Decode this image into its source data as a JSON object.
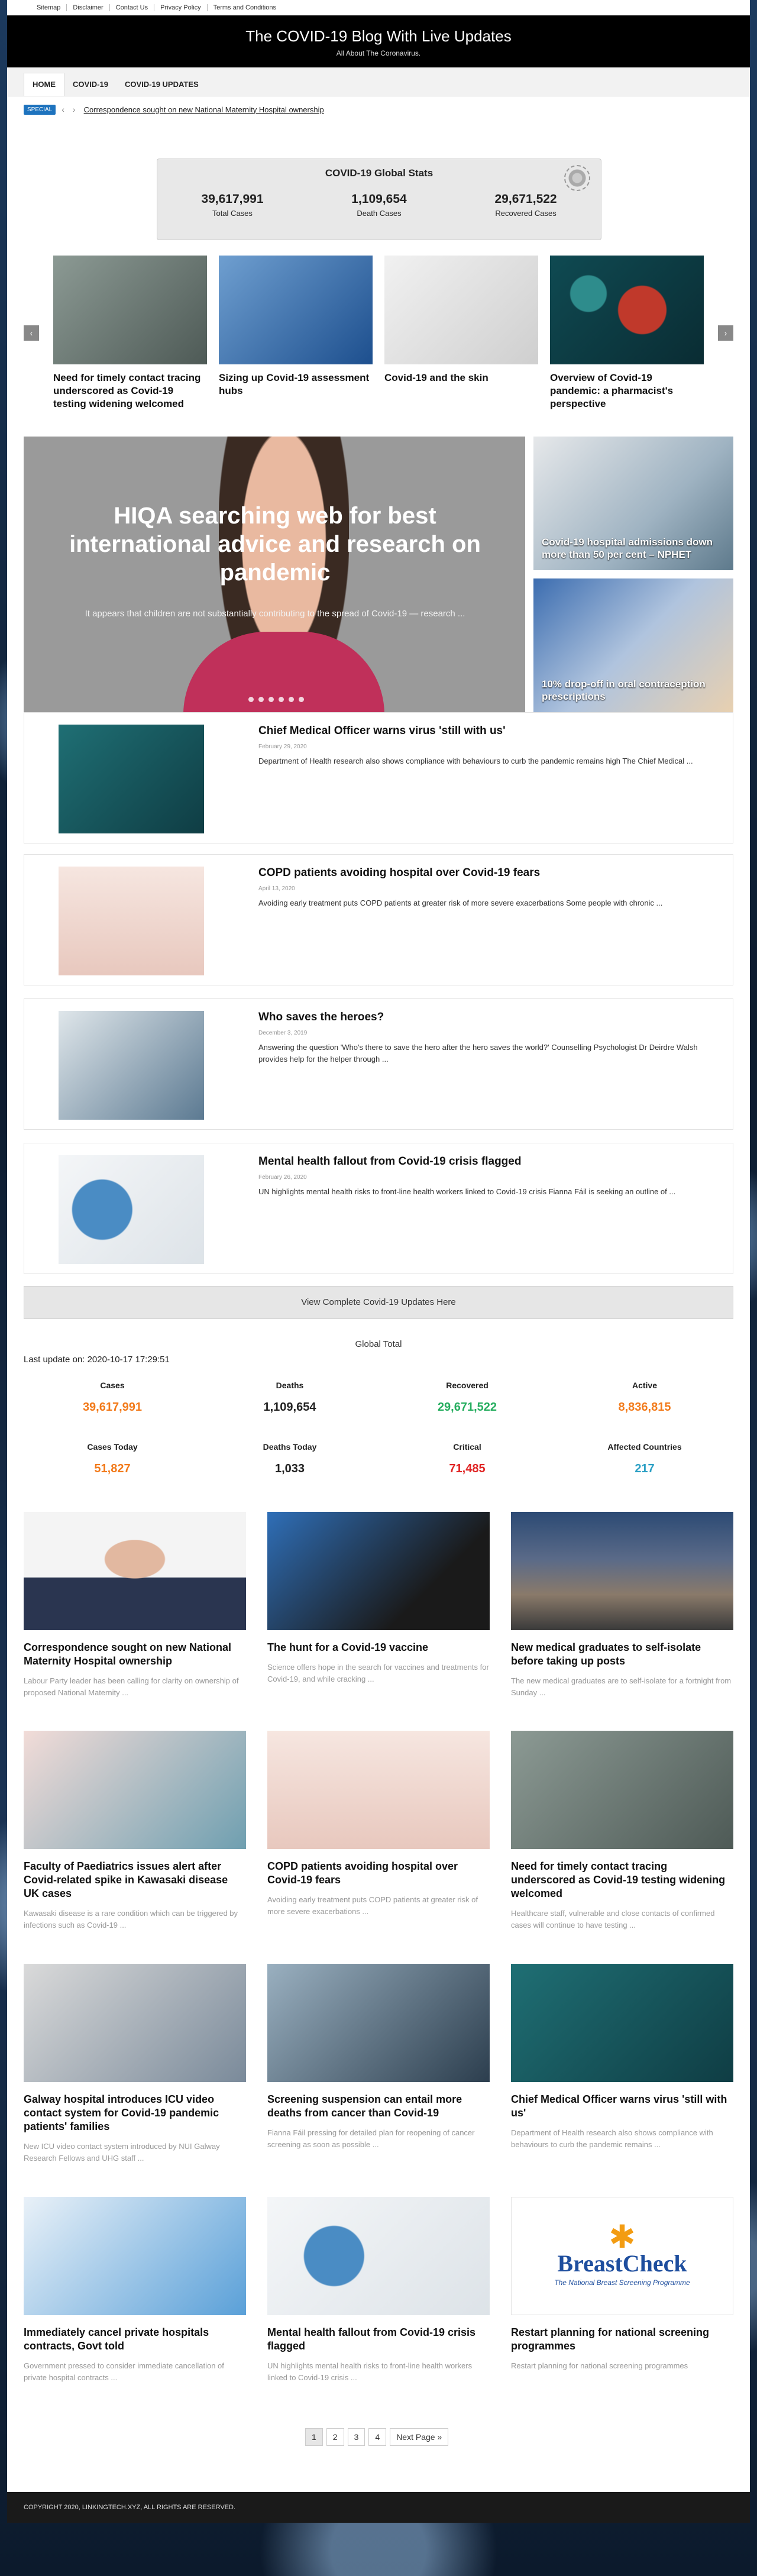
{
  "top_links": [
    "Sitemap",
    "Disclaimer",
    "Contact Us",
    "Privacy Policy",
    "Terms and Conditions"
  ],
  "header": {
    "title": "The COVID-19 Blog With Live Updates",
    "subtitle": "All About The Coronavirus."
  },
  "nav": [
    "HOME",
    "COVID-19",
    "COVID-19 UPDATES"
  ],
  "ticker": {
    "badge": "SPECIAL",
    "prev": "‹",
    "next": "›",
    "headline": "Correspondence sought on new National Maternity Hospital ownership"
  },
  "global_stats": {
    "title": "COVID-19 Global Stats",
    "items": [
      {
        "value": "39,617,991",
        "label": "Total Cases"
      },
      {
        "value": "1,109,654",
        "label": "Death Cases"
      },
      {
        "value": "29,671,522",
        "label": "Recovered Cases"
      }
    ]
  },
  "carousel": {
    "prev": "‹",
    "next": "›",
    "items": [
      {
        "title": "Need for timely contact tracing underscored as Covid-19 testing widening welcomed",
        "image": "gray"
      },
      {
        "title": "Sizing up Covid-19 assessment hubs",
        "image": "blue"
      },
      {
        "title": "Covid-19 and the skin",
        "image": "light"
      },
      {
        "title": "Overview of Covid-19 pandemic: a pharmacist's perspective",
        "image": "teal"
      }
    ]
  },
  "hero": {
    "title": "HIQA searching web for best international advice and research on pandemic",
    "excerpt": "It appears that children are not substantially contributing to the spread of Covid-19 — research ...",
    "slides": 6
  },
  "side_features": [
    {
      "title": "Covid-19 hospital admissions down more than 50 per cent – NPHET"
    },
    {
      "title": "10% drop-off in oral contraception prescriptions"
    }
  ],
  "posts": [
    {
      "title": "Chief Medical Officer warns virus 'still with us'",
      "date": "February 29, 2020",
      "excerpt": "Department of Health research also shows compliance with behaviours to curb the pandemic remains high The Chief Medical ..."
    },
    {
      "title": "COPD patients avoiding hospital over Covid-19 fears",
      "date": "April 13, 2020",
      "excerpt": "Avoiding early treatment puts COPD patients at greater risk of more severe exacerbations Some people with chronic ..."
    },
    {
      "title": "Who saves the heroes?",
      "date": "December 3, 2019",
      "excerpt": "Answering the question 'Who's there to save the hero after the hero saves the world?' Counselling Psychologist Dr Deirdre Walsh provides help for the helper through ..."
    },
    {
      "title": "Mental health fallout from Covid-19 crisis flagged",
      "date": "February 26, 2020",
      "excerpt": "UN highlights mental health risks to front-line health workers linked to Covid-19 crisis Fianna Fáil is seeking an outline of ..."
    }
  ],
  "view_all": "View Complete Covid-19 Updates Here",
  "global_total": {
    "title": "Global Total",
    "last_update": "Last update on: 2020-10-17 17:29:51",
    "cells": [
      {
        "label": "Cases",
        "value": "39,617,991",
        "color": "#f27a1a"
      },
      {
        "label": "Deaths",
        "value": "1,109,654",
        "color": "#222222"
      },
      {
        "label": "Recovered",
        "value": "29,671,522",
        "color": "#27ae60"
      },
      {
        "label": "Active",
        "value": "8,836,815",
        "color": "#f27a1a"
      },
      {
        "label": "Cases Today",
        "value": "51,827",
        "color": "#f27a1a"
      },
      {
        "label": "Deaths Today",
        "value": "1,033",
        "color": "#222222"
      },
      {
        "label": "Critical",
        "value": "71,485",
        "color": "#e02424"
      },
      {
        "label": "Affected Countries",
        "value": "217",
        "color": "#2a9fc4"
      }
    ]
  },
  "grid": [
    {
      "title": "Correspondence sought on new National Maternity Hospital ownership",
      "excerpt": "Labour Party leader has been calling for clarity on ownership of proposed National Maternity ..."
    },
    {
      "title": "The hunt for a Covid-19 vaccine",
      "excerpt": "Science offers hope in the search for vaccines and treatments for Covid-19, and while cracking ..."
    },
    {
      "title": "New medical graduates to self-isolate before taking up posts",
      "excerpt": "The new medical graduates are to self-isolate for a fortnight from Sunday ..."
    },
    {
      "title": "Faculty of Paediatrics issues alert after Covid-related spike in Kawasaki disease UK cases",
      "excerpt": "Kawasaki disease is a rare condition which can be triggered by infections such as Covid-19 ..."
    },
    {
      "title": "COPD patients avoiding hospital over Covid-19 fears",
      "excerpt": "Avoiding early treatment puts COPD patients at greater risk of more severe exacerbations ..."
    },
    {
      "title": "Need for timely contact tracing underscored as Covid-19 testing widening welcomed",
      "excerpt": "Healthcare staff, vulnerable and close contacts of confirmed cases will continue to have testing ..."
    },
    {
      "title": "Galway hospital introduces ICU video contact system for Covid-19 pandemic patients' families",
      "excerpt": "New ICU video contact system introduced by NUI Galway Research Fellows and UHG staff ..."
    },
    {
      "title": "Screening suspension can entail more deaths from cancer than Covid-19",
      "excerpt": "Fianna Fáil pressing for detailed plan for reopening of cancer screening as soon as possible ..."
    },
    {
      "title": "Chief Medical Officer warns virus 'still with us'",
      "excerpt": "Department of Health research also shows compliance with behaviours to curb the pandemic remains ..."
    },
    {
      "title": "Immediately cancel private hospitals contracts, Govt told",
      "excerpt": "Government pressed to consider immediate cancellation of private hospital contracts ..."
    },
    {
      "title": "Mental health fallout from Covid-19 crisis flagged",
      "excerpt": "UN highlights mental health risks to front-line health workers linked to Covid-19 crisis ..."
    },
    {
      "title": "Restart planning for national screening programmes",
      "excerpt": "Restart planning for national screening programmes"
    }
  ],
  "breastcheck": {
    "name": "BreastCheck",
    "tagline": "The National Breast Screening Programme"
  },
  "pagination": {
    "pages": [
      "1",
      "2",
      "3",
      "4"
    ],
    "next": "Next Page »"
  },
  "footer": "COPYRIGHT 2020, LINKINGTECH.XYZ, ALL RIGHTS ARE RESERVED."
}
